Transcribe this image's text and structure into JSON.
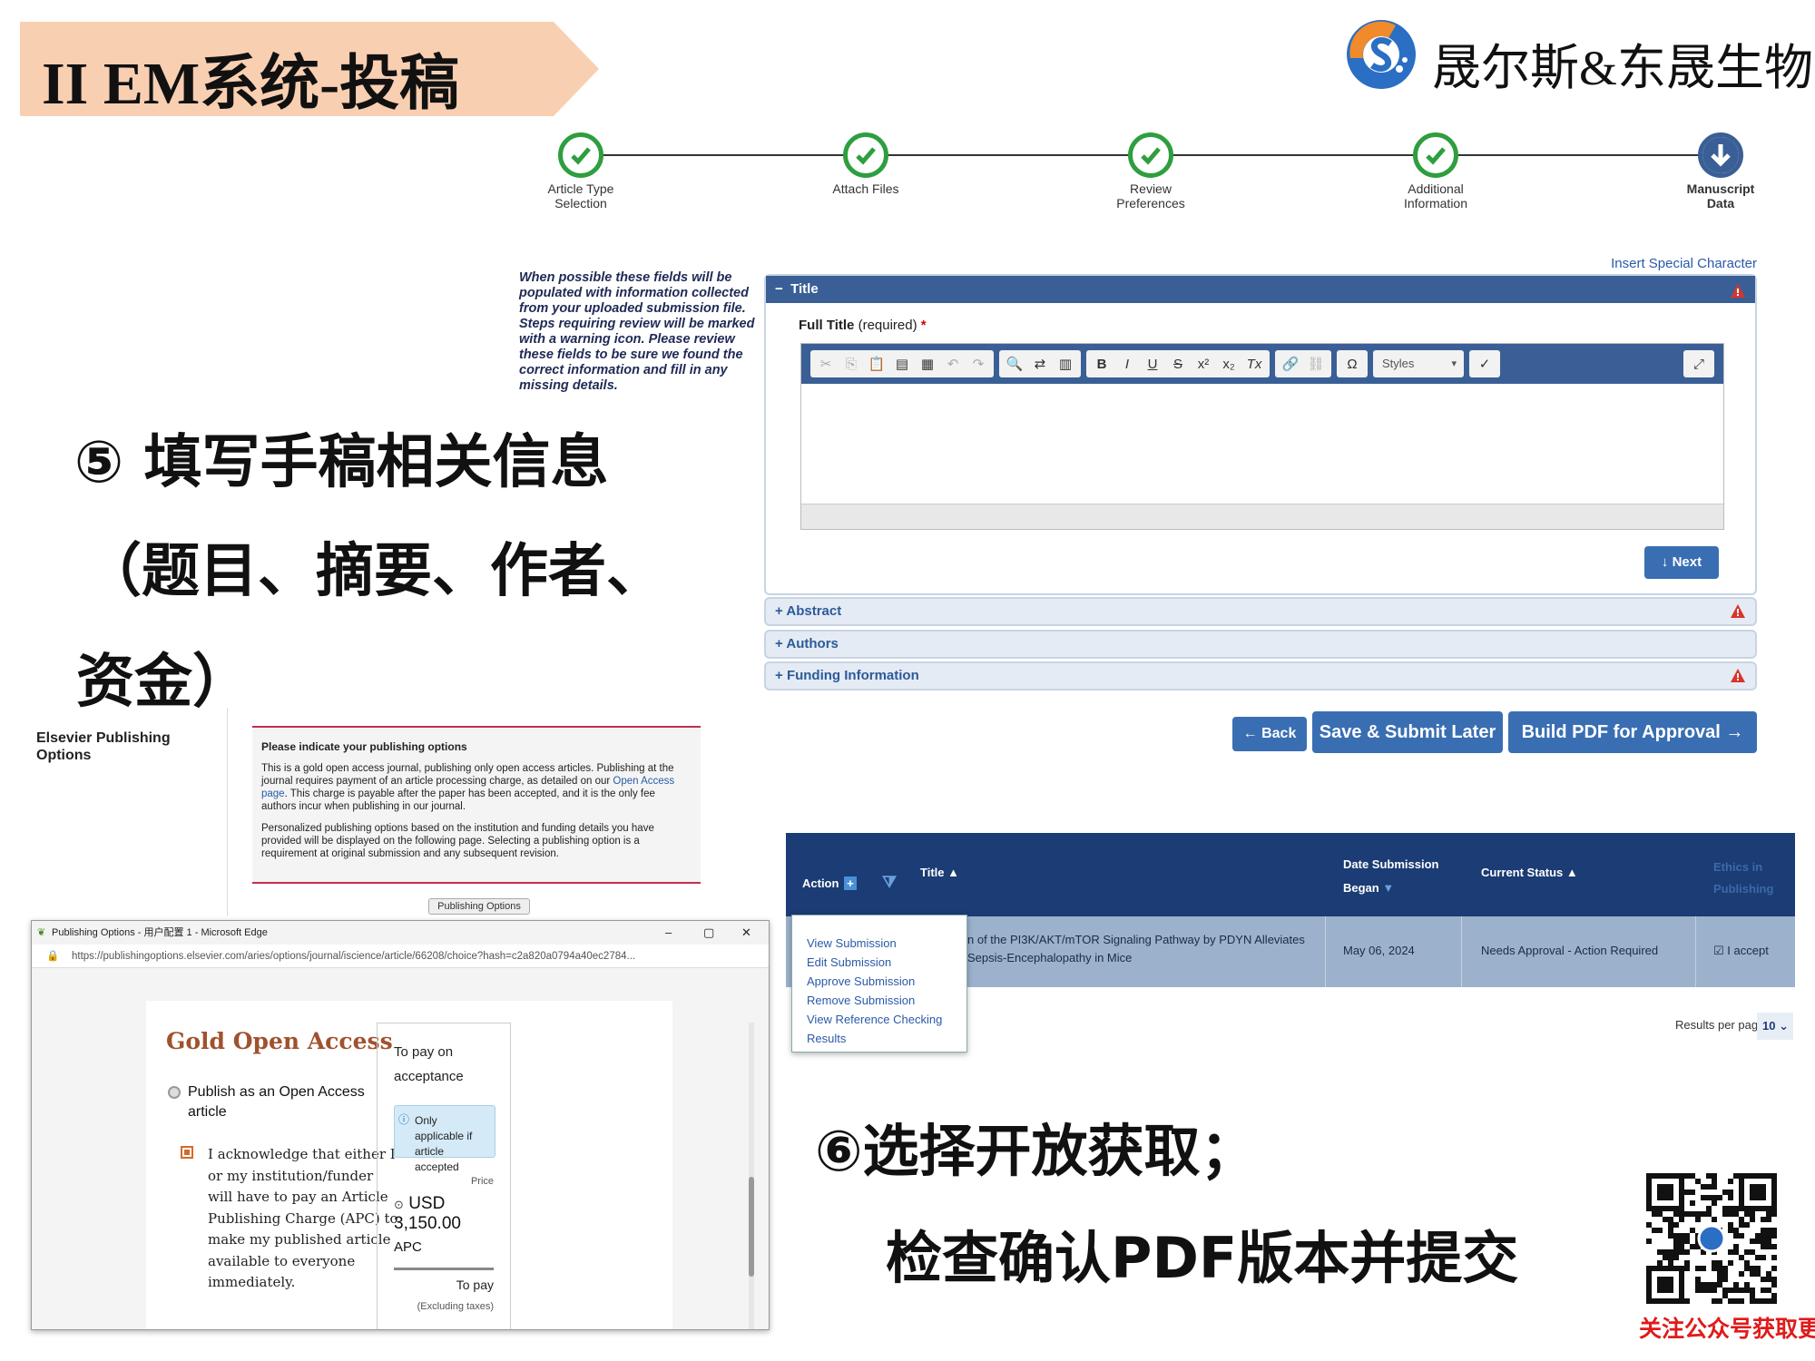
{
  "slide": {
    "title": "II EM系统-投稿",
    "logo_text": "晟尔斯&东晟生物",
    "step5_line1": "⑤ 填写手稿相关信息",
    "step5_line2": "（题目、摘要、作者、",
    "step5_line3": "资金）",
    "step6_line1": "⑥选择开放获取；",
    "step6_line2": "检查确认PDF版本并提交",
    "qr_caption": "关注公众号获取更多资讯"
  },
  "colors": {
    "banner": "#f9cfb2",
    "header_blue": "#3a5f96",
    "button_blue": "#3a6eb3",
    "check_green": "#2e9e3f",
    "warn_red": "#d9342b"
  },
  "progress": {
    "steps": [
      {
        "line1": "Article Type",
        "line2": "Selection",
        "icon": "check-icon"
      },
      {
        "line1": "Attach Files",
        "line2": "",
        "icon": "check-icon"
      },
      {
        "line1": "Review",
        "line2": "Preferences",
        "icon": "check-icon"
      },
      {
        "line1": "Additional",
        "line2": "Information",
        "icon": "check-icon"
      },
      {
        "line1": "Manuscript",
        "line2": "Data",
        "icon": "arrow-down-icon"
      }
    ]
  },
  "form": {
    "note": "When possible these fields will be populated with information collected from your uploaded submission file. Steps requiring review will be marked with a warning icon. Please review these fields to be sure we found the correct information and fill in any missing details.",
    "insert_special": "Insert Special Character",
    "title_header": "Title",
    "full_title_label": "Full Title",
    "required_text": "(required)",
    "required_star": "*",
    "styles_label": "Styles",
    "next_label": "Next",
    "abstract_label": "Abstract",
    "authors_label": "Authors",
    "funding_label": "Funding Information",
    "back_label": "Back",
    "save_label": "Save & Submit Later",
    "pdf_label": "Build PDF for Approval"
  },
  "elsevier": {
    "section_title": "Elsevier Publishing Options",
    "box_heading": "Please indicate your publishing options",
    "para1_a": "This is a gold open access journal, publishing only open access articles. Publishing at the journal requires payment of an article processing charge, as detailed on our ",
    "para1_link": "Open Access page",
    "para1_b": ". This charge is payable after the paper has been accepted, and it is the only fee authors incur when publishing in our journal.",
    "para2": "Personalized publishing options based on the institution and funding details you have provided will be displayed on the following page. Selecting a publishing option is a requirement at original submission and any subsequent revision.",
    "button_label": "Publishing Options"
  },
  "edge": {
    "window_title": "Publishing Options - 用户配置 1 - Microsoft Edge",
    "url": "https://publishingoptions.elsevier.com/aries/options/journal/iscience/article/66208/choice?hash=c2a820a0794a40ec2784...",
    "goa_title": "Gold Open Access",
    "radio_label": "Publish as an Open Access article",
    "ack_text": "I acknowledge that either I or my institution/funder will have to pay an Article Publishing Charge (APC) to make my published article available to everyone immediately.",
    "pay_title": "To pay on acceptance",
    "pay_note": "Only applicable if article accepted",
    "price_label": "Price",
    "price_value": "USD 3,150.00",
    "price_sub": "APC",
    "topay_label": "To pay",
    "excl_label": "(Excluding taxes)"
  },
  "table": {
    "col_action": "Action",
    "col_title": "Title",
    "col_date": "Date Submission Began",
    "col_status": "Current Status",
    "col_ethics": "Ethics in Publishing",
    "row_title": "n of the PI3K/AKT/mTOR Signaling Pathway by PDYN Alleviates Sepsis-Encephalopathy in Mice",
    "row_date": "May 06, 2024",
    "row_status": "Needs Approval - Action Required",
    "row_ethics": "I accept",
    "action_menu": [
      "View Submission",
      "Edit Submission",
      "Approve Submission",
      "Remove Submission",
      "View Reference Checking Results"
    ],
    "results_per_page_label": "Results per page",
    "results_per_page_value": "10"
  }
}
